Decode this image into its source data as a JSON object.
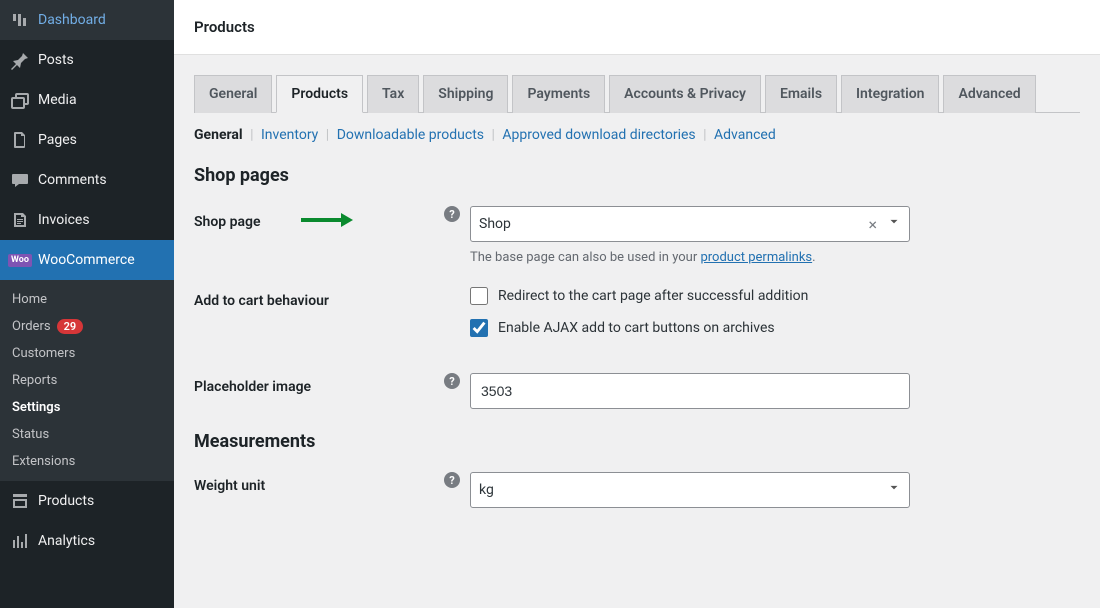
{
  "sidebar": {
    "items": [
      {
        "label": "Dashboard"
      },
      {
        "label": "Posts"
      },
      {
        "label": "Media"
      },
      {
        "label": "Pages"
      },
      {
        "label": "Comments"
      },
      {
        "label": "Invoices"
      },
      {
        "label": "WooCommerce"
      },
      {
        "label": "Products"
      },
      {
        "label": "Analytics"
      }
    ],
    "submenu": [
      {
        "label": "Home"
      },
      {
        "label": "Orders",
        "badge": "29"
      },
      {
        "label": "Customers"
      },
      {
        "label": "Reports"
      },
      {
        "label": "Settings"
      },
      {
        "label": "Status"
      },
      {
        "label": "Extensions"
      }
    ]
  },
  "header": {
    "title": "Products"
  },
  "tabs": [
    {
      "label": "General"
    },
    {
      "label": "Products"
    },
    {
      "label": "Tax"
    },
    {
      "label": "Shipping"
    },
    {
      "label": "Payments"
    },
    {
      "label": "Accounts & Privacy"
    },
    {
      "label": "Emails"
    },
    {
      "label": "Integration"
    },
    {
      "label": "Advanced"
    }
  ],
  "subtabs": [
    {
      "label": "General"
    },
    {
      "label": "Inventory"
    },
    {
      "label": "Downloadable products"
    },
    {
      "label": "Approved download directories"
    },
    {
      "label": "Advanced"
    }
  ],
  "sections": {
    "shop_pages": "Shop pages",
    "measurements": "Measurements"
  },
  "fields": {
    "shop_page": {
      "label": "Shop page",
      "value": "Shop",
      "description_pre": "The base page can also be used in your ",
      "description_link": "product permalinks",
      "description_post": "."
    },
    "add_to_cart": {
      "label": "Add to cart behaviour",
      "opt1": "Redirect to the cart page after successful addition",
      "opt2": "Enable AJAX add to cart buttons on archives"
    },
    "placeholder_image": {
      "label": "Placeholder image",
      "value": "3503"
    },
    "weight_unit": {
      "label": "Weight unit",
      "value": "kg"
    }
  }
}
